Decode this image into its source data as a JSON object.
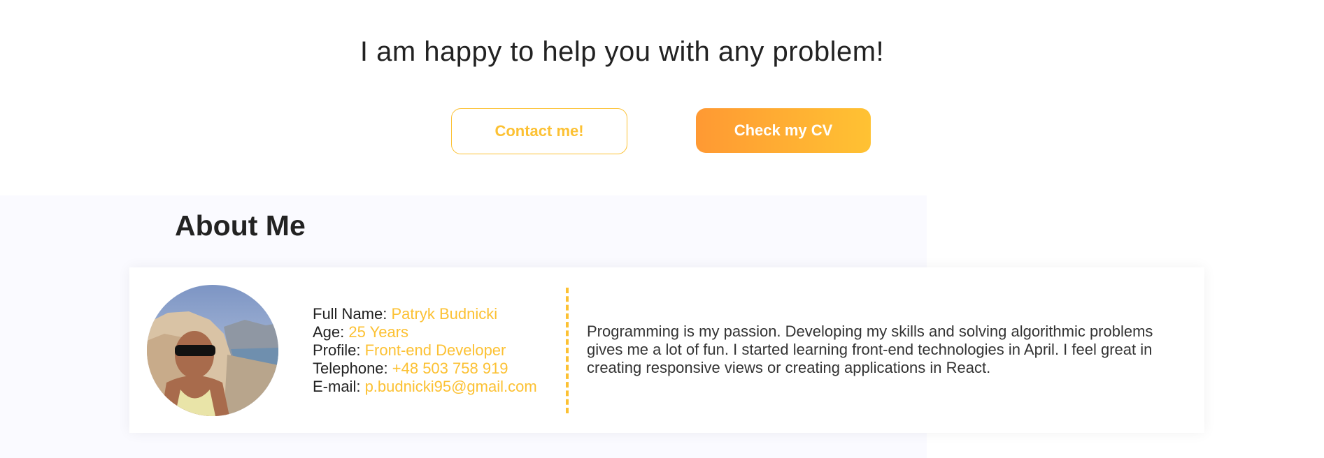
{
  "hero": {
    "heading": "I am happy to help you with any problem!",
    "contact_label": "Contact me!",
    "cv_label": "Check my CV"
  },
  "about": {
    "title": "About Me",
    "avatar_alt": "Photo of Patryk Budnicki",
    "info": [
      {
        "label": "Full Name: ",
        "value": "Patryk Budnicki"
      },
      {
        "label": "Age: ",
        "value": "25 Years"
      },
      {
        "label": "Profile: ",
        "value": "Front-end Developer"
      },
      {
        "label": "Telephone: ",
        "value": "+48 503 758 919"
      },
      {
        "label": "E-mail: ",
        "value": "p.budnicki95@gmail.com"
      }
    ],
    "bio": "Programming is my passion. Developing my skills and solving algorithmic problems gives me a lot of fun. I started learning front-end technologies in April. I feel great in creating responsive views or creating applications in React."
  },
  "colors": {
    "accent": "#fcc133",
    "gradient_start": "#ff9933",
    "gradient_end": "#ffc233",
    "section_bg": "#fafaff",
    "text": "#222222"
  }
}
